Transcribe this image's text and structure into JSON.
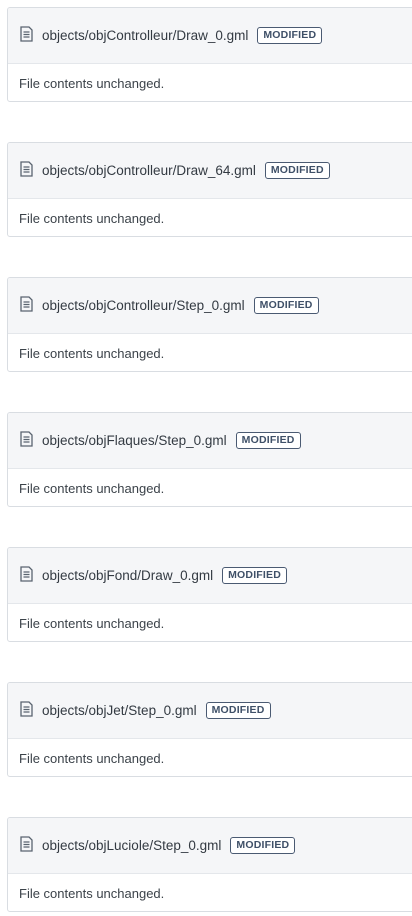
{
  "files": [
    {
      "path": "objects/objControlleur/Draw_0.gml",
      "badge": "MODIFIED",
      "status": "File contents unchanged.",
      "icon": "document-icon"
    },
    {
      "path": "objects/objControlleur/Draw_64.gml",
      "badge": "MODIFIED",
      "status": "File contents unchanged.",
      "icon": "document-icon"
    },
    {
      "path": "objects/objControlleur/Step_0.gml",
      "badge": "MODIFIED",
      "status": "File contents unchanged.",
      "icon": "document-icon"
    },
    {
      "path": "objects/objFlaques/Step_0.gml",
      "badge": "MODIFIED",
      "status": "File contents unchanged.",
      "icon": "document-icon"
    },
    {
      "path": "objects/objFond/Draw_0.gml",
      "badge": "MODIFIED",
      "status": "File contents unchanged.",
      "icon": "document-icon"
    },
    {
      "path": "objects/objJet/Step_0.gml",
      "badge": "MODIFIED",
      "status": "File contents unchanged.",
      "icon": "document-icon"
    },
    {
      "path": "objects/objLuciole/Step_0.gml",
      "badge": "MODIFIED",
      "status": "File contents unchanged.",
      "icon": "document-icon"
    }
  ],
  "colors": {
    "header_bg": "#f5f6f8",
    "border": "#d9dde2",
    "badge_border": "#4a5a72",
    "text": "#333a42"
  }
}
